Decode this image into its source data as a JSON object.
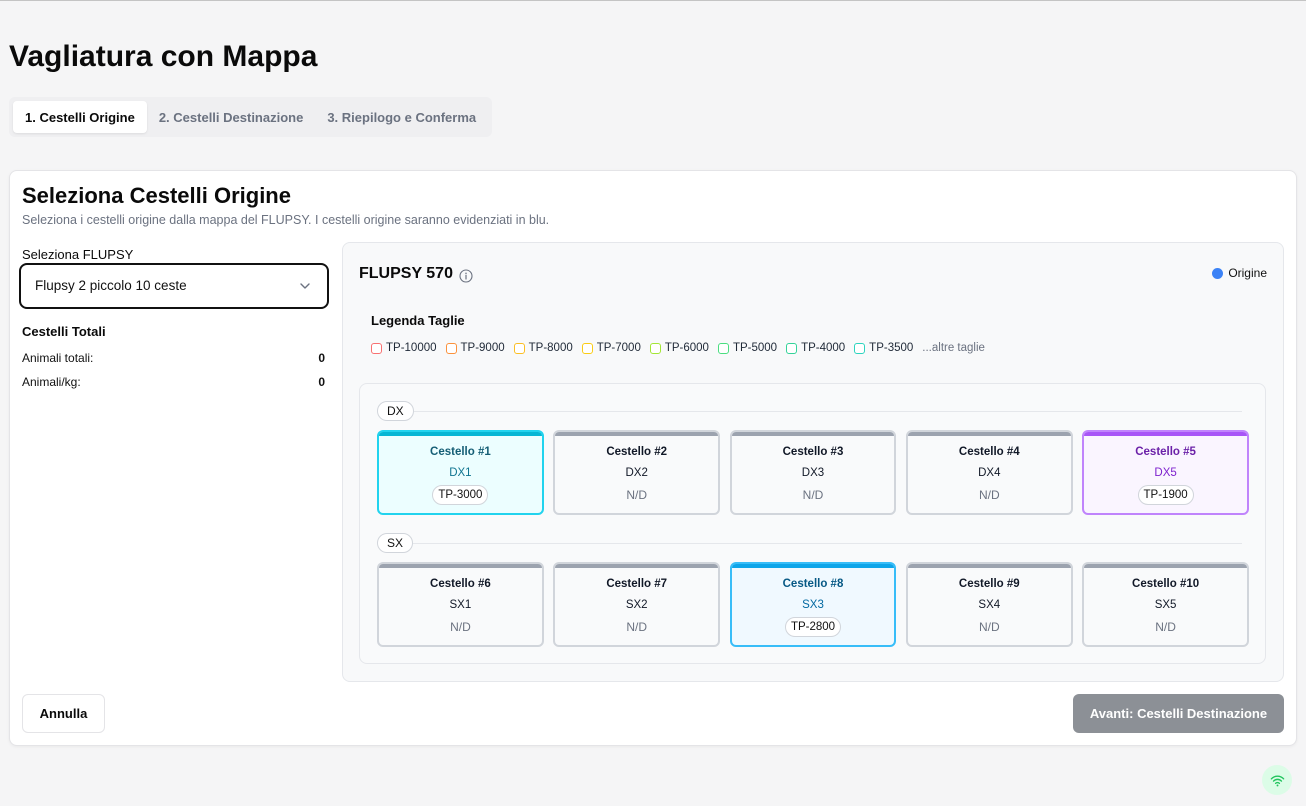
{
  "page": {
    "title": "Vagliatura con Mappa"
  },
  "tabs": [
    {
      "label": "1. Cestelli Origine",
      "active": true
    },
    {
      "label": "2. Cestelli Destinazione",
      "active": false
    },
    {
      "label": "3. Riepilogo e Conferma",
      "active": false
    }
  ],
  "step": {
    "title": "Seleziona Cestelli Origine",
    "description": "Seleziona i cestelli origine dalla mappa del FLUPSY. I cestelli origine saranno evidenziati in blu."
  },
  "sidebar": {
    "flupsy_label": "Seleziona FLUPSY",
    "flupsy_selected": "Flupsy 2 piccolo 10 ceste",
    "select_icon": "chevron-down-icon",
    "totals_title": "Cestelli Totali",
    "stats": [
      {
        "label": "Animali totali:",
        "value": "0"
      },
      {
        "label": "Animali/kg:",
        "value": "0"
      }
    ]
  },
  "map": {
    "title": "FLUPSY 570",
    "info_icon": "info-icon",
    "legend": {
      "label": "Origine",
      "color": "#3b82f6"
    },
    "size_legend": {
      "title": "Legenda Taglie",
      "items": [
        {
          "label": "TP-10000",
          "color": "#f87171"
        },
        {
          "label": "TP-9000",
          "color": "#fb923c"
        },
        {
          "label": "TP-8000",
          "color": "#fbbf24"
        },
        {
          "label": "TP-7000",
          "color": "#facc15"
        },
        {
          "label": "TP-6000",
          "color": "#a3e635"
        },
        {
          "label": "TP-5000",
          "color": "#4ade80"
        },
        {
          "label": "TP-4000",
          "color": "#34d399"
        },
        {
          "label": "TP-3500",
          "color": "#2dd4bf"
        }
      ],
      "more": "...altre taglie"
    },
    "rows": [
      {
        "label": "DX",
        "baskets": [
          {
            "name": "Cestello #1",
            "code": "DX1",
            "size": "TP-3000",
            "assigned": true,
            "accent_color": "#06b6d4",
            "border_color": "#22d3ee",
            "bg_color": "#ecfeff",
            "title_color": "#155e75",
            "code_color": "#0e7490"
          },
          {
            "name": "Cestello #2",
            "code": "DX2",
            "size": "N/D",
            "assigned": false
          },
          {
            "name": "Cestello #3",
            "code": "DX3",
            "size": "N/D",
            "assigned": false
          },
          {
            "name": "Cestello #4",
            "code": "DX4",
            "size": "N/D",
            "assigned": false
          },
          {
            "name": "Cestello #5",
            "code": "DX5",
            "size": "TP-1900",
            "assigned": true,
            "accent_color": "#a855f7",
            "border_color": "#c084fc",
            "bg_color": "#faf5ff",
            "title_color": "#6b21a8",
            "code_color": "#7e22ce"
          }
        ]
      },
      {
        "label": "SX",
        "baskets": [
          {
            "name": "Cestello #6",
            "code": "SX1",
            "size": "N/D",
            "assigned": false
          },
          {
            "name": "Cestello #7",
            "code": "SX2",
            "size": "N/D",
            "assigned": false
          },
          {
            "name": "Cestello #8",
            "code": "SX3",
            "size": "TP-2800",
            "assigned": true,
            "accent_color": "#0ea5e9",
            "border_color": "#38bdf8",
            "bg_color": "#f0f9ff",
            "title_color": "#075985",
            "code_color": "#0369a1"
          },
          {
            "name": "Cestello #9",
            "code": "SX4",
            "size": "N/D",
            "assigned": false
          },
          {
            "name": "Cestello #10",
            "code": "SX5",
            "size": "N/D",
            "assigned": false
          }
        ]
      }
    ]
  },
  "footer": {
    "cancel_label": "Annulla",
    "next_label": "Avanti: Cestelli Destinazione",
    "next_enabled": false
  },
  "status": {
    "icon": "wifi-icon",
    "color": "#22c55e"
  }
}
